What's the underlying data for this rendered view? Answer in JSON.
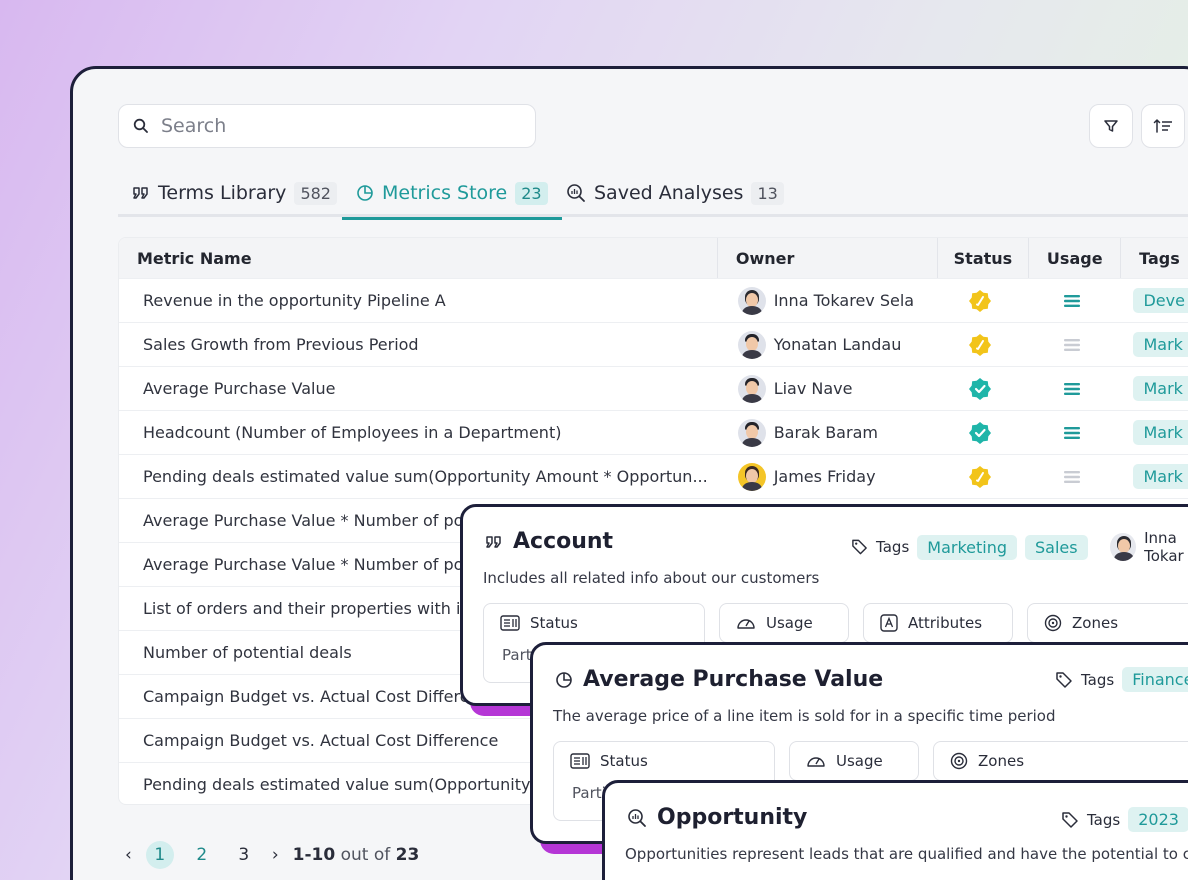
{
  "search": {
    "placeholder": "Search"
  },
  "tabs": [
    {
      "label": "Terms Library",
      "count": "582"
    },
    {
      "label": "Metrics Store",
      "count": "23"
    },
    {
      "label": "Saved Analyses",
      "count": "13"
    }
  ],
  "table": {
    "headers": [
      "Metric Name",
      "Owner",
      "Status",
      "Usage",
      "Tags"
    ],
    "rows": [
      {
        "name": "Revenue in the opportunity Pipeline A",
        "owner": "Inna Tokarev Sela",
        "status": "pending",
        "usage": "high",
        "tag": "Deve"
      },
      {
        "name": "Sales Growth from Previous Period",
        "owner": "Yonatan Landau",
        "status": "pending",
        "usage": "low",
        "tag": "Mark"
      },
      {
        "name": "Average Purchase Value",
        "owner": "Liav Nave",
        "status": "verified",
        "usage": "high",
        "tag": "Mark"
      },
      {
        "name": "Headcount (Number of Employees in a Department)",
        "owner": "Barak Baram",
        "status": "verified",
        "usage": "high",
        "tag": "Mark"
      },
      {
        "name": "Pending deals estimated value sum(Opportunity Amount * Opportun...",
        "owner": "James Friday",
        "status": "pending",
        "usage": "low",
        "tag": "Mark"
      },
      {
        "name": "Average Purchase Value * Number of pot"
      },
      {
        "name": "Average Purchase Value * Number of pot"
      },
      {
        "name": "List of orders and their properties with it"
      },
      {
        "name": "Number of potential deals"
      },
      {
        "name": "Campaign Budget vs. Actual Cost Differe"
      },
      {
        "name": "Campaign Budget vs. Actual Cost Difference"
      },
      {
        "name": "Pending deals estimated value sum(Opportunity A"
      }
    ]
  },
  "pagination": {
    "prev": "‹",
    "pages": [
      "1",
      "2",
      "3"
    ],
    "next": "›",
    "range": "1-10",
    "out_of": "out of",
    "total": "23"
  },
  "cards": {
    "account": {
      "title": "Account",
      "description": "Includes all related info about our customers",
      "tags_label": "Tags",
      "tags": [
        "Marketing",
        "Sales"
      ],
      "owner": "Inna Tokar",
      "sections": [
        "Status",
        "Usage",
        "Attributes",
        "Zones"
      ],
      "status_value": "Parti"
    },
    "apv": {
      "title": "Average Purchase Value",
      "description": "The average price of a line item is sold for in a specific time period",
      "tags_label": "Tags",
      "tags": [
        "Finance"
      ],
      "sections": [
        "Status",
        "Usage",
        "Zones"
      ],
      "status_value": "Parti"
    },
    "opportunity": {
      "title": "Opportunity",
      "description": "Opportunities represent leads that are qualified and have the potential to con",
      "tags_label": "Tags",
      "tags": [
        "2023"
      ]
    }
  },
  "colors": {
    "accent": "#1f9a9a",
    "pending": "#f2c41a",
    "verified": "#1fb5a9",
    "shadow": "#b536d6",
    "border": "#1d1f3a"
  }
}
